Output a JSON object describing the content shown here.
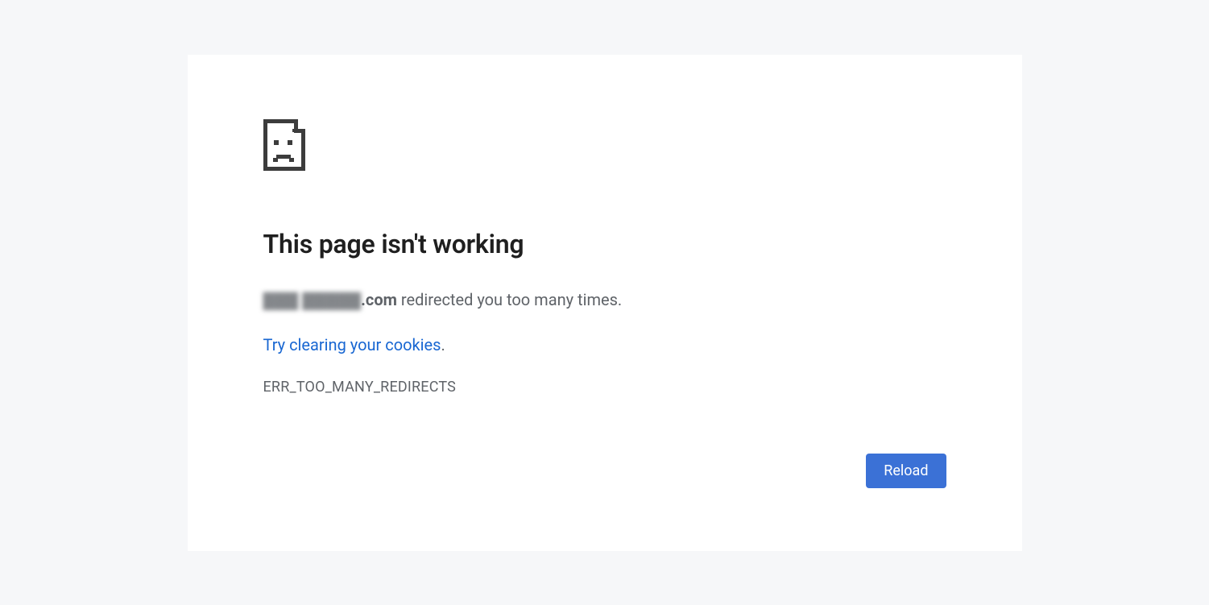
{
  "heading": "This page isn't working",
  "domain_hidden": "▓▓▓ ▓▓▓▓▓",
  "domain_suffix": ".com",
  "message_tail": " redirected you too many times.",
  "link_text": "Try clearing your cookies",
  "link_period": ".",
  "error_code": "ERR_TOO_MANY_REDIRECTS",
  "reload_label": "Reload"
}
